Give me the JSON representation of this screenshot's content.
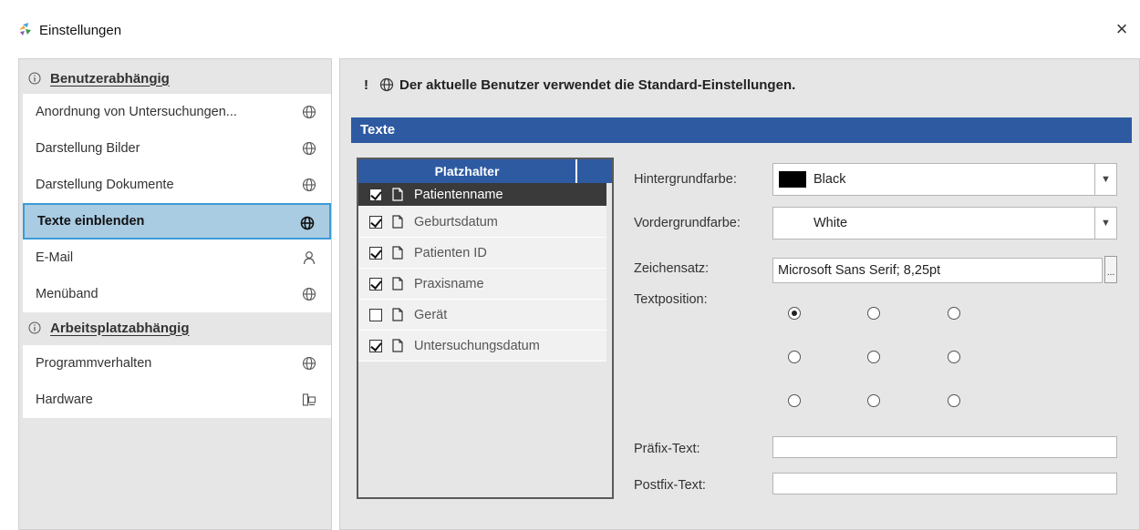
{
  "window": {
    "title": "Einstellungen",
    "close_glyph": "×",
    "app_icon": "app-logo-icon"
  },
  "sidebar": {
    "sections": [
      {
        "label": "Benutzerabhängig",
        "items": [
          {
            "label": "Anordnung von Untersuchungen...",
            "icon": "globe-icon"
          },
          {
            "label": "Darstellung Bilder",
            "icon": "globe-icon"
          },
          {
            "label": "Darstellung Dokumente",
            "icon": "globe-icon"
          },
          {
            "label": "Texte einblenden",
            "icon": "globe-icon",
            "selected": true
          },
          {
            "label": "E-Mail",
            "icon": "user-icon"
          },
          {
            "label": "Menüband",
            "icon": "globe-icon"
          }
        ]
      },
      {
        "label": "Arbeitsplatzabhängig",
        "items": [
          {
            "label": "Programmverhalten",
            "icon": "globe-icon"
          },
          {
            "label": "Hardware",
            "icon": "workstation-icon"
          }
        ]
      }
    ]
  },
  "main": {
    "info_exclamation": "!",
    "info_text": "Der aktuelle Benutzer verwendet die Standard-Einstellungen.",
    "section_title": "Texte",
    "placeholder_list": {
      "header": "Platzhalter",
      "items": [
        {
          "label": "Patientenname",
          "checked": true,
          "selected": true
        },
        {
          "label": "Geburtsdatum",
          "checked": true
        },
        {
          "label": "Patienten ID",
          "checked": true
        },
        {
          "label": "Praxisname",
          "checked": true
        },
        {
          "label": "Gerät",
          "checked": false
        },
        {
          "label": "Untersuchungsdatum",
          "checked": true
        }
      ]
    },
    "form": {
      "background_label": "Hintergrundfarbe:",
      "background_value": "Black",
      "background_swatch": "#000000",
      "foreground_label": "Vordergrundfarbe:",
      "foreground_value": "White",
      "foreground_swatch": "#ffffff",
      "font_label": "Zeichensatz:",
      "font_value": "Microsoft Sans Serif; 8,25pt",
      "font_button": "...",
      "position_label": "Textposition:",
      "position_selected": "top-left",
      "prefix_label": "Präfix-Text:",
      "prefix_value": "",
      "postfix_label": "Postfix-Text:",
      "postfix_value": ""
    }
  },
  "colors": {
    "accent": "#2e5aa2",
    "selection": "#a9cce3",
    "selection_border": "#3c9bd6",
    "panel": "#e6e6e6"
  }
}
